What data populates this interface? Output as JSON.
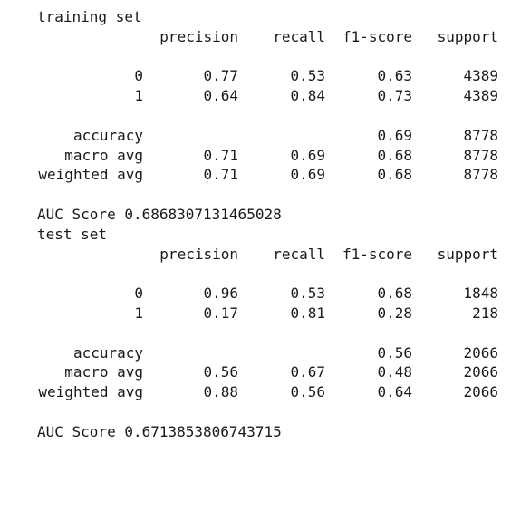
{
  "sections": [
    {
      "title": "training set",
      "headers": {
        "precision": "precision",
        "recall": "recall",
        "f1": "f1-score",
        "support": "support"
      },
      "rows": [
        {
          "label": "0",
          "precision": "0.77",
          "recall": "0.53",
          "f1": "0.63",
          "support": "4389"
        },
        {
          "label": "1",
          "precision": "0.64",
          "recall": "0.84",
          "f1": "0.73",
          "support": "4389"
        }
      ],
      "accuracy": {
        "label": "accuracy",
        "f1": "0.69",
        "support": "8778"
      },
      "macro": {
        "label": "macro avg",
        "precision": "0.71",
        "recall": "0.69",
        "f1": "0.68",
        "support": "8778"
      },
      "weighted": {
        "label": "weighted avg",
        "precision": "0.71",
        "recall": "0.69",
        "f1": "0.68",
        "support": "8778"
      },
      "auc": "AUC Score 0.6868307131465028"
    },
    {
      "title": "test set",
      "headers": {
        "precision": "precision",
        "recall": "recall",
        "f1": "f1-score",
        "support": "support"
      },
      "rows": [
        {
          "label": "0",
          "precision": "0.96",
          "recall": "0.53",
          "f1": "0.68",
          "support": "1848"
        },
        {
          "label": "1",
          "precision": "0.17",
          "recall": "0.81",
          "f1": "0.28",
          "support": "218"
        }
      ],
      "accuracy": {
        "label": "accuracy",
        "f1": "0.56",
        "support": "2066"
      },
      "macro": {
        "label": "macro avg",
        "precision": "0.56",
        "recall": "0.67",
        "f1": "0.48",
        "support": "2066"
      },
      "weighted": {
        "label": "weighted avg",
        "precision": "0.88",
        "recall": "0.56",
        "f1": "0.64",
        "support": "2066"
      },
      "auc": "AUC Score 0.6713853806743715"
    }
  ]
}
